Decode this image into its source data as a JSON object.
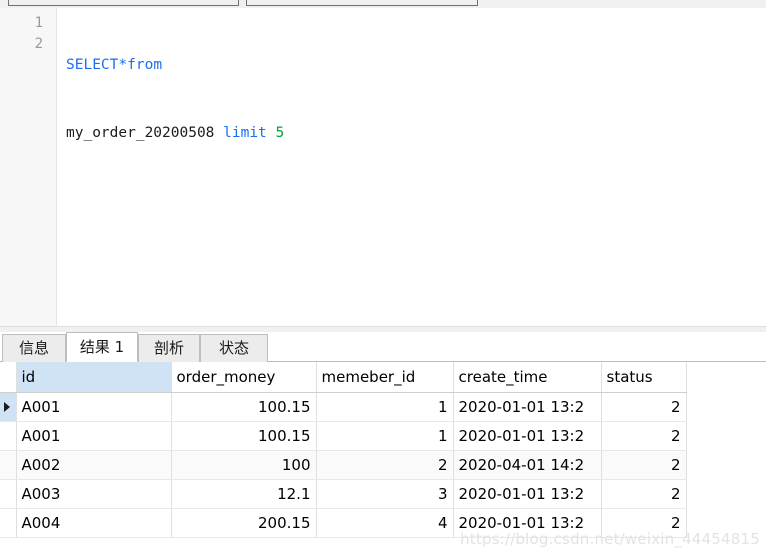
{
  "top_panels": {
    "box_1_label": "",
    "box_2_label": ""
  },
  "editor": {
    "line_numbers": [
      "1",
      "2"
    ],
    "line1": {
      "keyword_select": "SELECT",
      "operator_star": "*",
      "keyword_from": "from"
    },
    "line2": {
      "table_name": "my_order_20200508",
      "keyword_limit": "limit",
      "limit_value": "5"
    },
    "full_sql": "SELECT*from\nmy_order_20200508 limit 5",
    "colors": {
      "keyword": "#1a6fef",
      "identifier": "#1c1c1c",
      "number": "#00a03e",
      "gutter_bg": "#f7f7f7",
      "gutter_text": "#9a9a9a"
    }
  },
  "tabs": {
    "active_index": 1,
    "items": [
      {
        "label": "信息",
        "active": false
      },
      {
        "label": "结果 1",
        "active": true
      },
      {
        "label": "剖析",
        "active": false
      },
      {
        "label": "状态",
        "active": false
      }
    ]
  },
  "grid": {
    "selected_column": "id",
    "current_row_index": 0,
    "row_caret_glyph": "▶",
    "columns": [
      "id",
      "order_money",
      "memeber_id",
      "create_time",
      "status"
    ],
    "rows": [
      {
        "id": "A001",
        "order_money": "100.15",
        "memeber_id": "1",
        "create_time": "2020-01-01 13:2",
        "status": "2"
      },
      {
        "id": "A001",
        "order_money": "100.15",
        "memeber_id": "1",
        "create_time": "2020-01-01 13:2",
        "status": "2"
      },
      {
        "id": "A002",
        "order_money": "100",
        "memeber_id": "2",
        "create_time": "2020-04-01 14:2",
        "status": "2"
      },
      {
        "id": "A003",
        "order_money": "12.1",
        "memeber_id": "3",
        "create_time": "2020-01-01 13:2",
        "status": "2"
      },
      {
        "id": "A004",
        "order_money": "200.15",
        "memeber_id": "4",
        "create_time": "2020-01-01 13:2",
        "status": "2"
      }
    ],
    "selected_header_color": "#cfe3f5"
  },
  "watermark": {
    "text": "https://blog.csdn.net/weixin_44454815"
  }
}
